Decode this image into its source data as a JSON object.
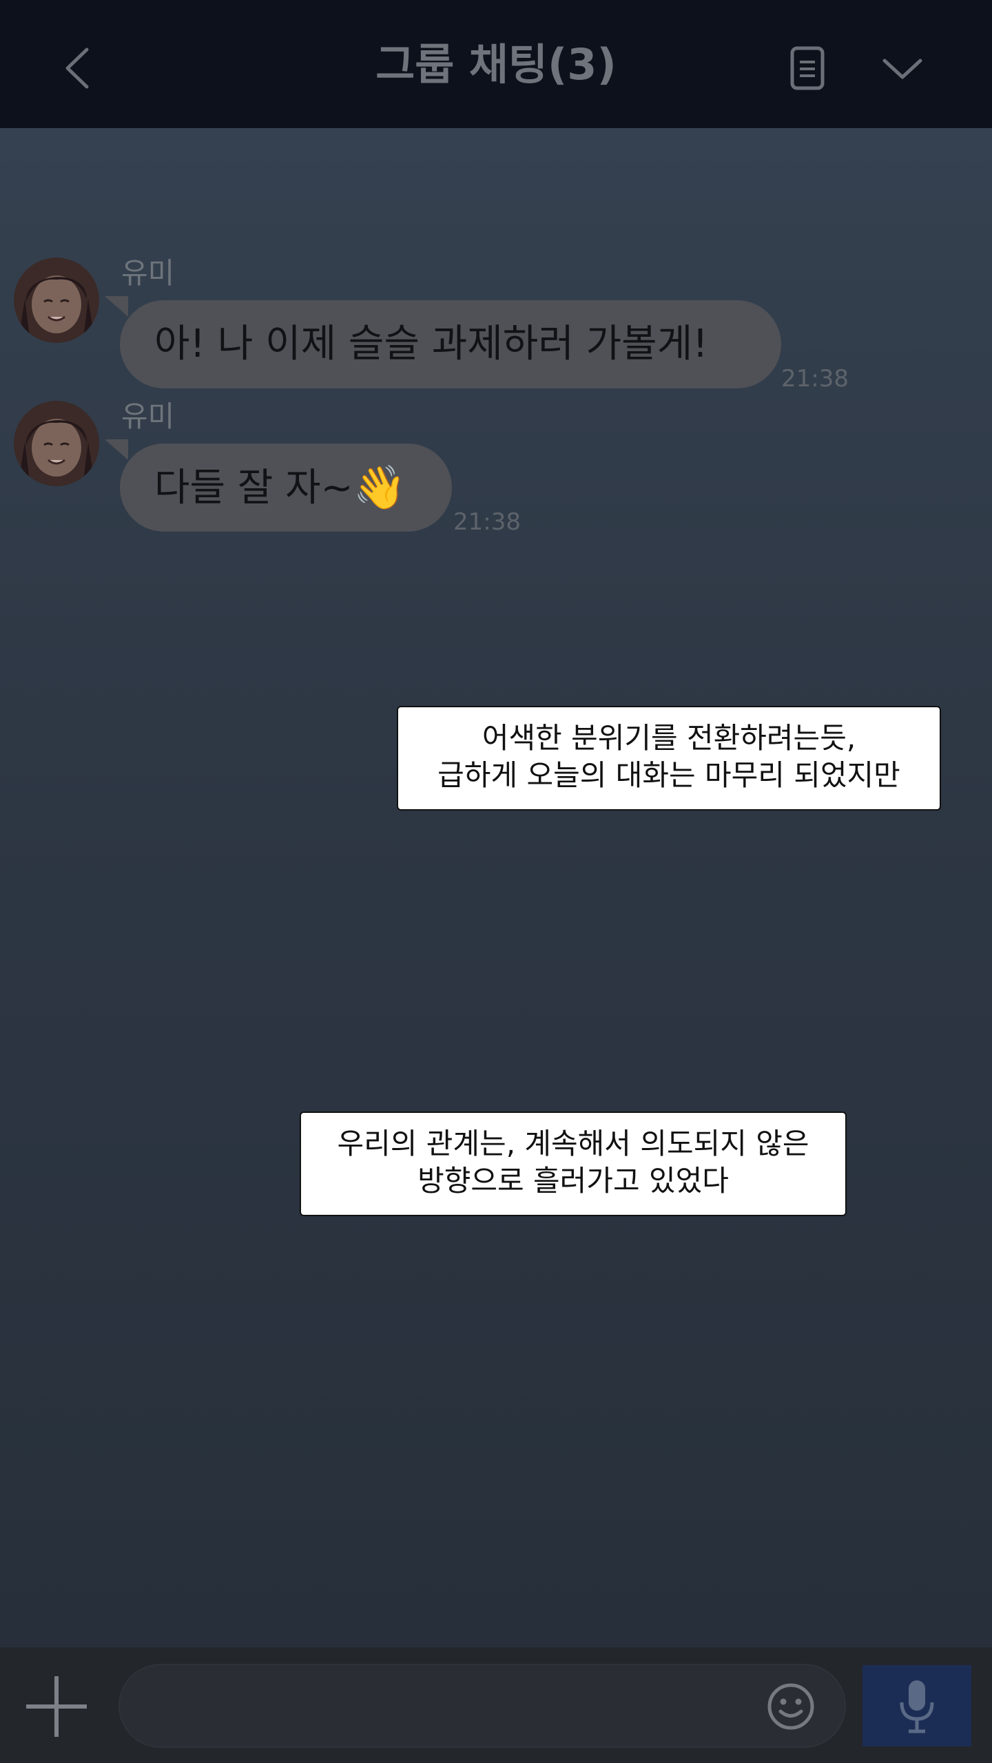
{
  "header": {
    "title": "그룹 채팅(3)",
    "icons": [
      "back-arrow-icon",
      "notes-icon",
      "chevron-down-icon"
    ]
  },
  "messages": [
    {
      "sender": "유미",
      "text": "아! 나 이제 슬슬 과제하러 가볼게!",
      "time": "21:38"
    },
    {
      "sender": "유미",
      "text": "다들 잘 자~",
      "emoji": "👋",
      "time": "21:38"
    }
  ],
  "narration": [
    {
      "lines": [
        "어색한 분위기를 전환하려는듯,",
        "급하게 오늘의 대화는 마무리 되었지만"
      ]
    },
    {
      "lines": [
        "우리의 관계는, 계속해서 의도되지 않은",
        "방향으로 흘러가고 있었다"
      ]
    }
  ],
  "input_bar": {
    "icons": [
      "plus-icon",
      "smiley-icon",
      "microphone-icon"
    ],
    "colors": {
      "mic_button": "#1c2d55"
    }
  },
  "colors": {
    "header_bg": "#0d111b",
    "chat_bg": "#2d3643",
    "bubble": "#4f5156"
  }
}
